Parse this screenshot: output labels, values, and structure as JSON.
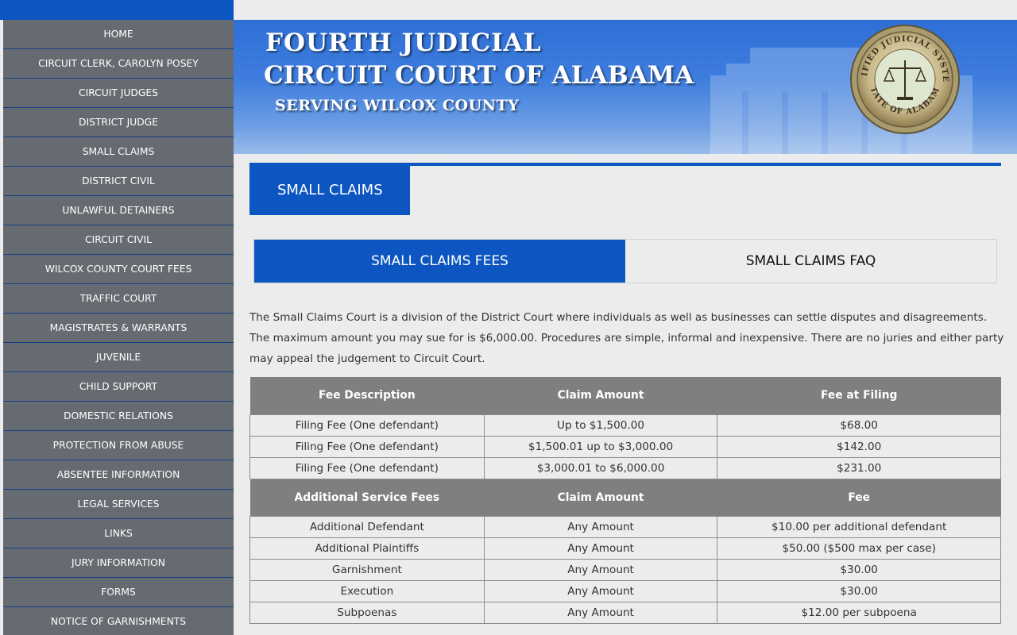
{
  "sidebar": {
    "items": [
      "HOME",
      "CIRCUIT CLERK, CAROLYN POSEY",
      "CIRCUIT JUDGES",
      "DISTRICT JUDGE",
      "SMALL CLAIMS",
      "DISTRICT CIVIL",
      "UNLAWFUL DETAINERS",
      "CIRCUIT CIVIL",
      "WILCOX COUNTY COURT FEES",
      "TRAFFIC COURT",
      "MAGISTRATES & WARRANTS",
      "JUVENILE",
      "CHILD SUPPORT",
      "DOMESTIC RELATIONS",
      "PROTECTION FROM ABUSE",
      "ABSENTEE INFORMATION",
      "LEGAL SERVICES",
      "LINKS",
      "JURY INFORMATION",
      "FORMS",
      "NOTICE OF GARNISHMENTS"
    ]
  },
  "banner": {
    "line1": "FOURTH  JUDICIAL",
    "line2": "CIRCUIT COURT OF ALABAMA",
    "line3": "SERVING WILCOX COUNTY",
    "seal_top": "UNIFIED JUDICIAL SYSTEM",
    "seal_bottom": "STATE OF ALABAMA"
  },
  "section": {
    "title": "SMALL CLAIMS"
  },
  "tabs": [
    {
      "label": "SMALL CLAIMS FEES",
      "active": true
    },
    {
      "label": "SMALL CLAIMS FAQ",
      "active": false
    }
  ],
  "intro": "The Small Claims Court is a division of the District Court where individuals as well as businesses can settle disputes and disagreements. The maximum amount you may sue for is $6,000.00. Procedures are simple, informal and inexpensive. There are no juries and either party may appeal the judgement to Circuit Court.",
  "fees_table": {
    "header1": [
      "Fee Description",
      "Claim Amount",
      "Fee at Filing"
    ],
    "rows1": [
      [
        "Filing Fee (One defendant)",
        "Up to $1,500.00",
        "$68.00"
      ],
      [
        "Filing Fee (One defendant)",
        "$1,500.01 up to $3,000.00",
        "$142.00"
      ],
      [
        "Filing Fee (One defendant)",
        "$3,000.01 to $6,000.00",
        "$231.00"
      ]
    ],
    "header2": [
      "Additional Service Fees",
      "Claim Amount",
      "Fee"
    ],
    "rows2": [
      [
        "Additional Defendant",
        "Any Amount",
        "$10.00 per additional defendant"
      ],
      [
        "Additional Plaintiffs",
        "Any Amount",
        "$50.00 ($500 max per case)"
      ],
      [
        "Garnishment",
        "Any Amount",
        "$30.00"
      ],
      [
        "Execution",
        "Any Amount",
        "$30.00"
      ],
      [
        "Subpoenas",
        "Any Amount",
        "$12.00 per subpoena"
      ]
    ]
  },
  "colors": {
    "brand_blue": "#0d55c0",
    "nav_gray": "#656b70",
    "table_header_gray": "#7f7f7f",
    "page_bg": "#ececec"
  }
}
